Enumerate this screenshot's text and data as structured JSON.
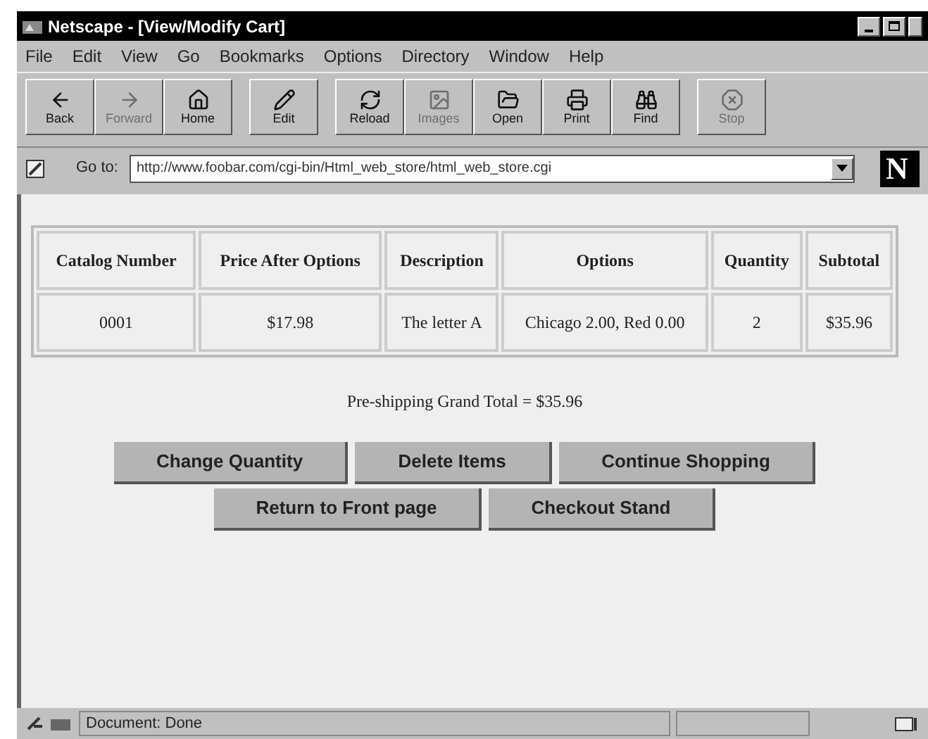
{
  "window": {
    "title": "Netscape - [View/Modify Cart]"
  },
  "menu": [
    "File",
    "Edit",
    "View",
    "Go",
    "Bookmarks",
    "Options",
    "Directory",
    "Window",
    "Help"
  ],
  "toolbar": [
    {
      "kind": "back",
      "label": "Back",
      "disabled": false
    },
    {
      "kind": "forward",
      "label": "Forward",
      "disabled": true
    },
    {
      "kind": "home",
      "label": "Home",
      "disabled": false
    },
    {
      "kind": "edit",
      "label": "Edit",
      "disabled": false
    },
    {
      "kind": "reload",
      "label": "Reload",
      "disabled": false
    },
    {
      "kind": "images",
      "label": "Images",
      "disabled": true
    },
    {
      "kind": "open",
      "label": "Open",
      "disabled": false
    },
    {
      "kind": "print",
      "label": "Print",
      "disabled": false
    },
    {
      "kind": "find",
      "label": "Find",
      "disabled": false
    },
    {
      "kind": "stop",
      "label": "Stop",
      "disabled": true
    }
  ],
  "location": {
    "label": "Go to:",
    "value": "http://www.foobar.com/cgi-bin/Html_web_store/html_web_store.cgi",
    "logo": "N"
  },
  "table": {
    "columns": [
      "Catalog Number",
      "Price After Options",
      "Description",
      "Options",
      "Quantity",
      "Subtotal"
    ],
    "rows": [
      [
        "0001",
        "$17.98",
        "The letter A",
        "Chicago 2.00, Red 0.00",
        "2",
        "$35.96"
      ]
    ]
  },
  "grand_total": "Pre-shipping Grand Total = $35.96",
  "buttons": [
    [
      "Change Quantity",
      "Delete Items",
      "Continue Shopping"
    ],
    [
      "Return to Front page",
      "Checkout Stand"
    ]
  ],
  "status_bar": {
    "text": "Document: Done"
  }
}
